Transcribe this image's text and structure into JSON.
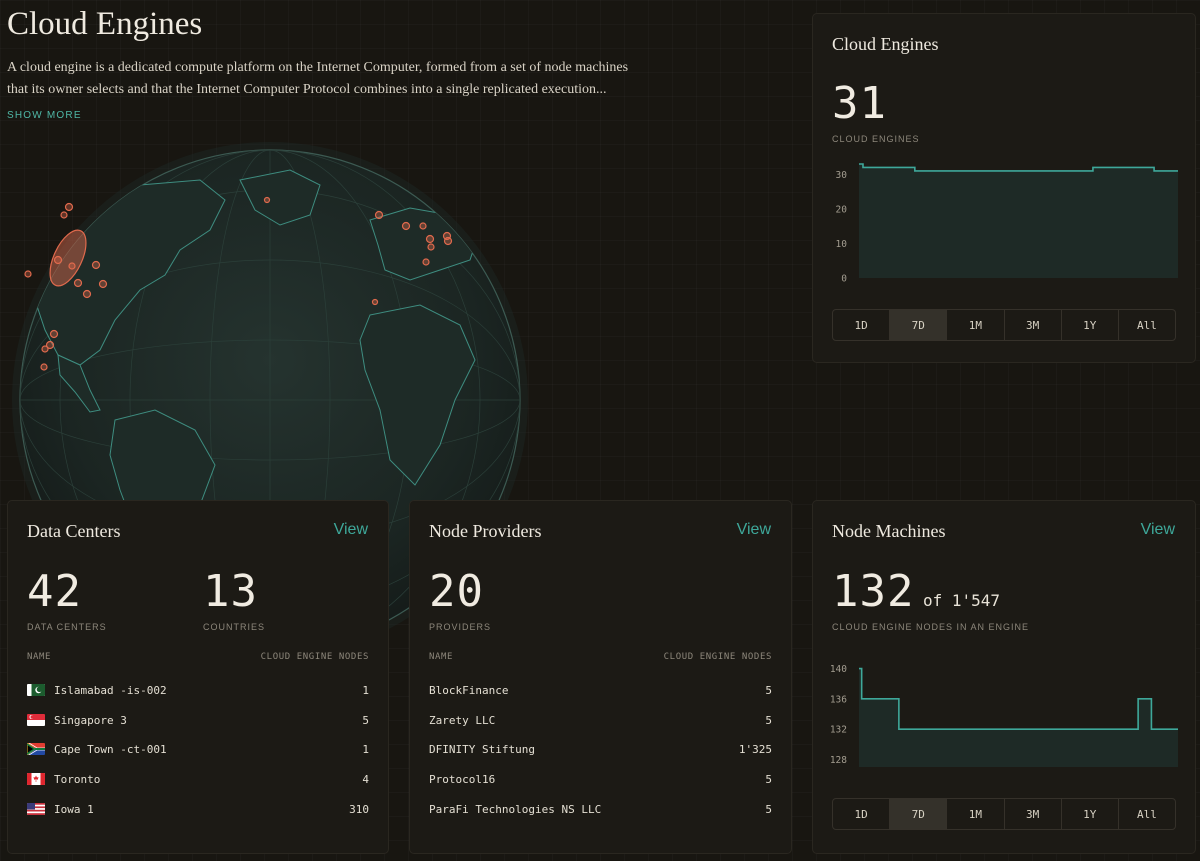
{
  "header": {
    "title": "Cloud Engines",
    "description": "A cloud engine is a dedicated compute platform on the Internet Computer, formed from a set of node machines that its owner selects and that the Internet Computer Protocol combines into a single replicated execution...",
    "show_more": "SHOW MORE"
  },
  "colors": {
    "accent": "#3ea89a",
    "marker": "#e06a4d",
    "background": "#181611",
    "card": "#1c1a15"
  },
  "cloud_engines_card": {
    "title": "Cloud Engines",
    "count": "31",
    "count_label": "CLOUD ENGINES",
    "ranges": [
      "1D",
      "7D",
      "1M",
      "3M",
      "1Y",
      "All"
    ],
    "active_range": "7D"
  },
  "data_centers_card": {
    "title": "Data Centers",
    "view_label": "View",
    "stat1_value": "42",
    "stat1_label": "DATA CENTERS",
    "stat2_value": "13",
    "stat2_label": "COUNTRIES",
    "col_name": "NAME",
    "col_nodes": "CLOUD ENGINE NODES",
    "rows": [
      {
        "flag": "pakistan-flag-icon",
        "name": "Islamabad -is-002",
        "nodes": "1"
      },
      {
        "flag": "singapore-flag-icon",
        "name": "Singapore 3",
        "nodes": "5"
      },
      {
        "flag": "south-africa-flag-icon",
        "name": "Cape Town -ct-001",
        "nodes": "1"
      },
      {
        "flag": "canada-flag-icon",
        "name": "Toronto",
        "nodes": "4"
      },
      {
        "flag": "usa-flag-icon",
        "name": "Iowa 1",
        "nodes": "310"
      }
    ]
  },
  "node_providers_card": {
    "title": "Node Providers",
    "view_label": "View",
    "stat_value": "20",
    "stat_label": "PROVIDERS",
    "col_name": "NAME",
    "col_nodes": "CLOUD ENGINE NODES",
    "rows": [
      {
        "name": "BlockFinance",
        "nodes": "5"
      },
      {
        "name": "Zarety LLC",
        "nodes": "5"
      },
      {
        "name": "DFINITY Stiftung",
        "nodes": "1'325"
      },
      {
        "name": "Protocol16",
        "nodes": "5"
      },
      {
        "name": "ParaFi Technologies NS LLC",
        "nodes": "5"
      }
    ]
  },
  "node_machines_card": {
    "title": "Node Machines",
    "view_label": "View",
    "stat_value": "132",
    "stat_of": "of 1'547",
    "stat_label": "CLOUD ENGINE NODES IN AN ENGINE",
    "ranges": [
      "1D",
      "7D",
      "1M",
      "3M",
      "1Y",
      "All"
    ],
    "active_range": "7D"
  },
  "chart_data": [
    {
      "type": "line",
      "title": "",
      "step": true,
      "y_ticks": [
        0,
        10,
        20,
        30
      ],
      "ylim": [
        0,
        33
      ],
      "x": [
        0,
        0.3,
        4.2,
        10.8,
        17.6,
        22.2,
        24
      ],
      "values": [
        33,
        32,
        31,
        31,
        32,
        31,
        31
      ],
      "xlim": [
        0,
        24
      ],
      "fill": true
    },
    {
      "type": "line",
      "title": "",
      "step": true,
      "y_ticks": [
        128,
        132,
        136,
        140
      ],
      "ylim": [
        127,
        141
      ],
      "x": [
        0,
        0.3,
        4.5,
        19.2,
        31.5,
        33,
        36
      ],
      "values": [
        140,
        136,
        132,
        132,
        136,
        132,
        132
      ],
      "xlim": [
        0,
        36
      ],
      "fill": true
    }
  ],
  "globe": {
    "markers": 26
  }
}
